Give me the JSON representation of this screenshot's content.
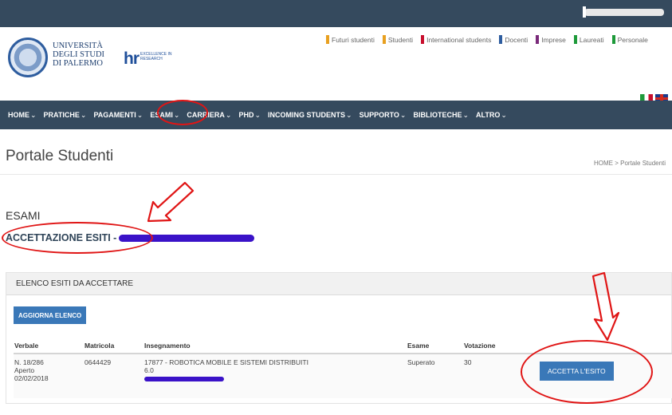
{
  "topbar": {
    "user_name": ""
  },
  "header": {
    "university_name_lines": [
      "UNIVERSITÀ",
      "DEGLI STUDI",
      "DI PALERMO"
    ],
    "hr_mark": "hr",
    "hr_subtext": "EXCELLENCE IN RESEARCH",
    "audience_links": [
      {
        "label": "Futuri studenti",
        "color": "#e8a020"
      },
      {
        "label": "Studenti",
        "color": "#e8a020"
      },
      {
        "label": "International students",
        "color": "#c8102e"
      },
      {
        "label": "Docenti",
        "color": "#2e5d9f"
      },
      {
        "label": "Imprese",
        "color": "#7a2a7a"
      },
      {
        "label": "Laureati",
        "color": "#1e9a3a"
      },
      {
        "label": "Personale",
        "color": "#1e9a3a"
      }
    ]
  },
  "nav": {
    "items": [
      {
        "label": "HOME"
      },
      {
        "label": "PRATICHE"
      },
      {
        "label": "PAGAMENTI"
      },
      {
        "label": "ESAMI"
      },
      {
        "label": "CARRIERA"
      },
      {
        "label": "PHD"
      },
      {
        "label": "INCOMING STUDENTS"
      },
      {
        "label": "SUPPORTO"
      },
      {
        "label": "BIBLIOTECHE"
      },
      {
        "label": "ALTRO"
      }
    ],
    "chevron": "⌄"
  },
  "page": {
    "title": "Portale Studenti",
    "breadcrumb": [
      "HOME",
      "Portale Studenti"
    ],
    "section_title": "ESAMI",
    "subsection_title": "ACCETTAZIONE ESITI -"
  },
  "panel": {
    "heading": "ELENCO ESITI DA ACCETTARE",
    "refresh_label": "AGGIORNA ELENCO",
    "columns": [
      "Verbale",
      "Matricola",
      "Insegnamento",
      "Esame",
      "Votazione"
    ],
    "rows": [
      {
        "verbale": [
          "N. 18/286",
          "Aperto",
          "02/02/2018"
        ],
        "matricola": "0644429",
        "insegnamento": "17877 - ROBOTICA MOBILE E SISTEMI DISTRIBUITI",
        "cfu": "6.0",
        "esame": "Superato",
        "votazione": "30",
        "action_label": "ACCETTA L'ESITO"
      }
    ]
  },
  "colors": {
    "navbar": "#354a5e",
    "button": "#3a78b8",
    "annotation": "#e01515",
    "redaction": "#3a12c8"
  }
}
